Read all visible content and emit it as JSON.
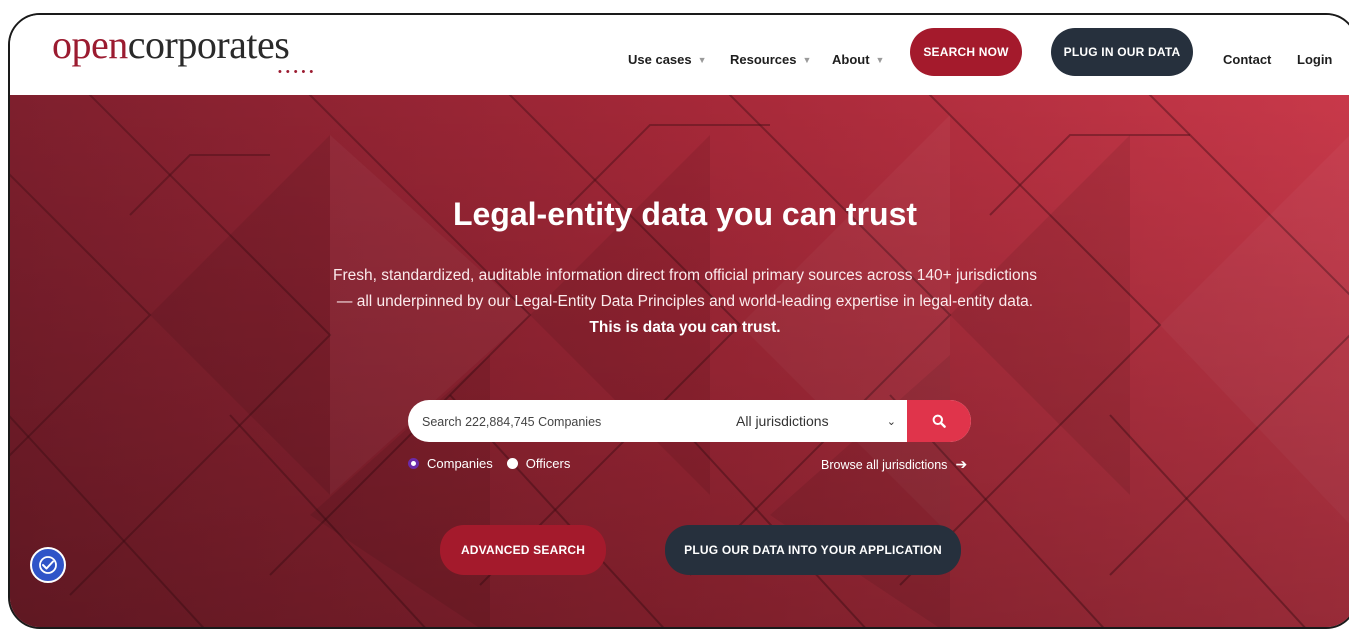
{
  "header": {
    "logo_open": "open",
    "logo_corp": "corporates",
    "logo_dots": "•••••",
    "nav": {
      "use_cases": "Use cases",
      "resources": "Resources",
      "about": "About",
      "contact": "Contact",
      "login": "Login"
    },
    "search_now": "SEARCH NOW",
    "plug_in": "PLUG IN OUR DATA"
  },
  "hero": {
    "title": "Legal-entity data you can trust",
    "subtitle_line1": "Fresh, standardized, auditable information direct from official primary sources across 140+ jurisdictions",
    "subtitle_line2": "— all underpinned by our Legal-Entity Data Principles and world-leading expertise in legal-entity data.",
    "subtitle_strong": "This is data you can trust."
  },
  "search": {
    "placeholder": "Search 222,884,745 Companies",
    "jurisdiction_selected": "All jurisdictions",
    "options": [
      {
        "label": "Companies",
        "checked": true
      },
      {
        "label": "Officers",
        "checked": false
      }
    ],
    "browse_link": "Browse all jurisdictions"
  },
  "actions": {
    "advanced_search": "ADVANCED SEARCH",
    "plug_into_app": "PLUG OUR DATA INTO YOUR APPLICATION"
  },
  "icons": {
    "chevron": "chevron-down-icon",
    "search": "search-icon",
    "arrow": "arrow-right-icon",
    "accessibility": "accessibility-icon"
  },
  "colors": {
    "brand_red": "#a41a2c",
    "search_red": "#e0344b",
    "dark": "#26303d",
    "radio_accent": "#6b2aa8"
  }
}
